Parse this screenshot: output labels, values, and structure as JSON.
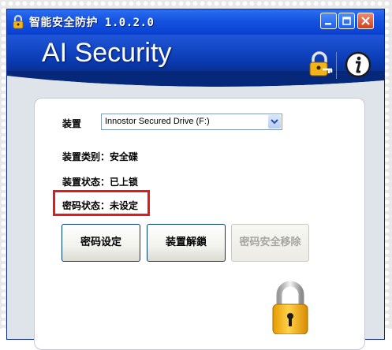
{
  "window": {
    "title": "智能安全防护 1.0.2.0"
  },
  "banner": {
    "brand": "AI Security",
    "icons": [
      "lock-key-icon",
      "info-icon"
    ]
  },
  "device": {
    "label": "装置",
    "selected": "Innostor Secured Drive (F:)"
  },
  "info": {
    "type_line": "装置类别：安全碟",
    "status_line": "装置状态：已上锁",
    "password_line": "密码状态：未设定"
  },
  "buttons": {
    "set_password": "密码设定",
    "unlock": "装置解鎖",
    "remove_password": "密码安全移除"
  },
  "colors": {
    "titlebar": "#0a3fd0",
    "banner": "#0b3cb5",
    "highlight": "#e01b1b",
    "lock_gold": "#f2b418"
  }
}
